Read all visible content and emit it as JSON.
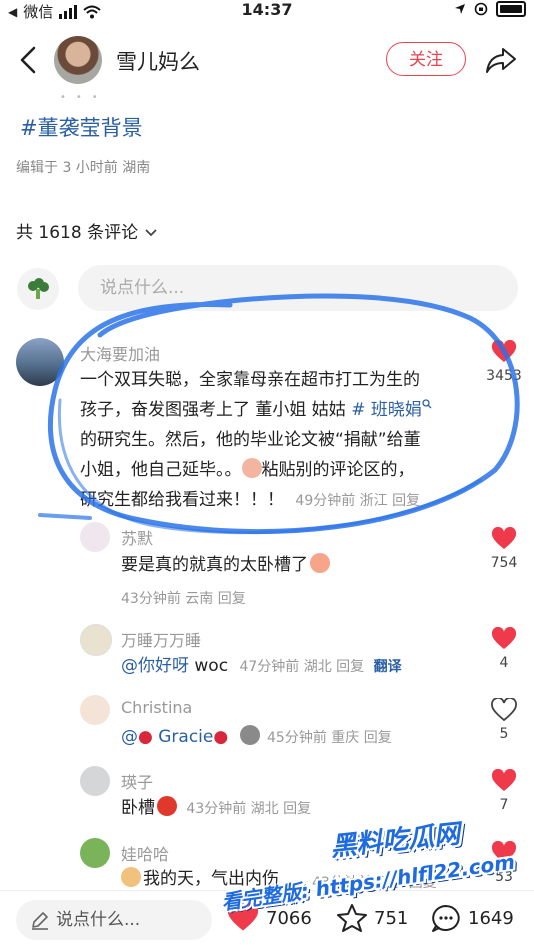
{
  "status_bar": {
    "carrier": "微信",
    "time": "14:37"
  },
  "header": {
    "title": "雪儿妈么",
    "follow_label": "关注"
  },
  "post": {
    "hashtag": "#董袭莹背景",
    "meta": "编辑于 3 小时前 湖南"
  },
  "comments_header": {
    "count": "共 1618 条评论",
    "chevron": "chevron-down-icon"
  },
  "comment_input": {
    "placeholder": "说点什么..."
  },
  "comments": [
    {
      "name": "大海要加油",
      "lines": [
        "一个双耳失聪，全家靠母亲在超市打工为生的",
        "孩子，奋发图强考上了 董小姐 姑姑 ",
        "的研究生。然后，他的毕业论文被“捐献”给董",
        "小姐，他自己延毕。。",
        "研究生都给我看过来！！！"
      ],
      "link": "# 班晓娟",
      "tail_text": "粘贴别的评论区的，",
      "meta": "49分钟前 浙江 回复",
      "likes": "3453",
      "liked": true
    },
    {
      "name": "苏默",
      "text": "要是真的就真的太卧槽了",
      "meta": "43分钟前 云南 回复",
      "likes": "754",
      "liked": true
    },
    {
      "name": "万睡万万睡",
      "mention": "@你好呀",
      "text": " woc",
      "meta": "47分钟前 湖北 回复",
      "translate": "翻译",
      "likes": "4",
      "liked": true
    },
    {
      "name": "Christina",
      "mention": "@",
      "mention2": "Gracie",
      "meta": "45分钟前 重庆 回复",
      "likes": "5",
      "liked": false
    },
    {
      "name": "瑛子",
      "text": "卧槽",
      "meta": "43分钟前 湖北 回复",
      "likes": "7",
      "liked": true
    },
    {
      "name": "娃哈哈",
      "text": "我的天，气出内伤",
      "meta": "43分钟前 辽宁 回复",
      "likes": "53",
      "liked": true
    }
  ],
  "bottom_bar": {
    "input_placeholder": "说点什么...",
    "likes": "7066",
    "stars": "751",
    "comments": "1649"
  },
  "watermark": {
    "line1": "黑料吃瓜网",
    "line2": "看完整版: https://hlfl22.com"
  },
  "colors": {
    "accent": "#e8434f",
    "link": "#2b5fa3",
    "overlay_blue": "#1e6be0"
  }
}
